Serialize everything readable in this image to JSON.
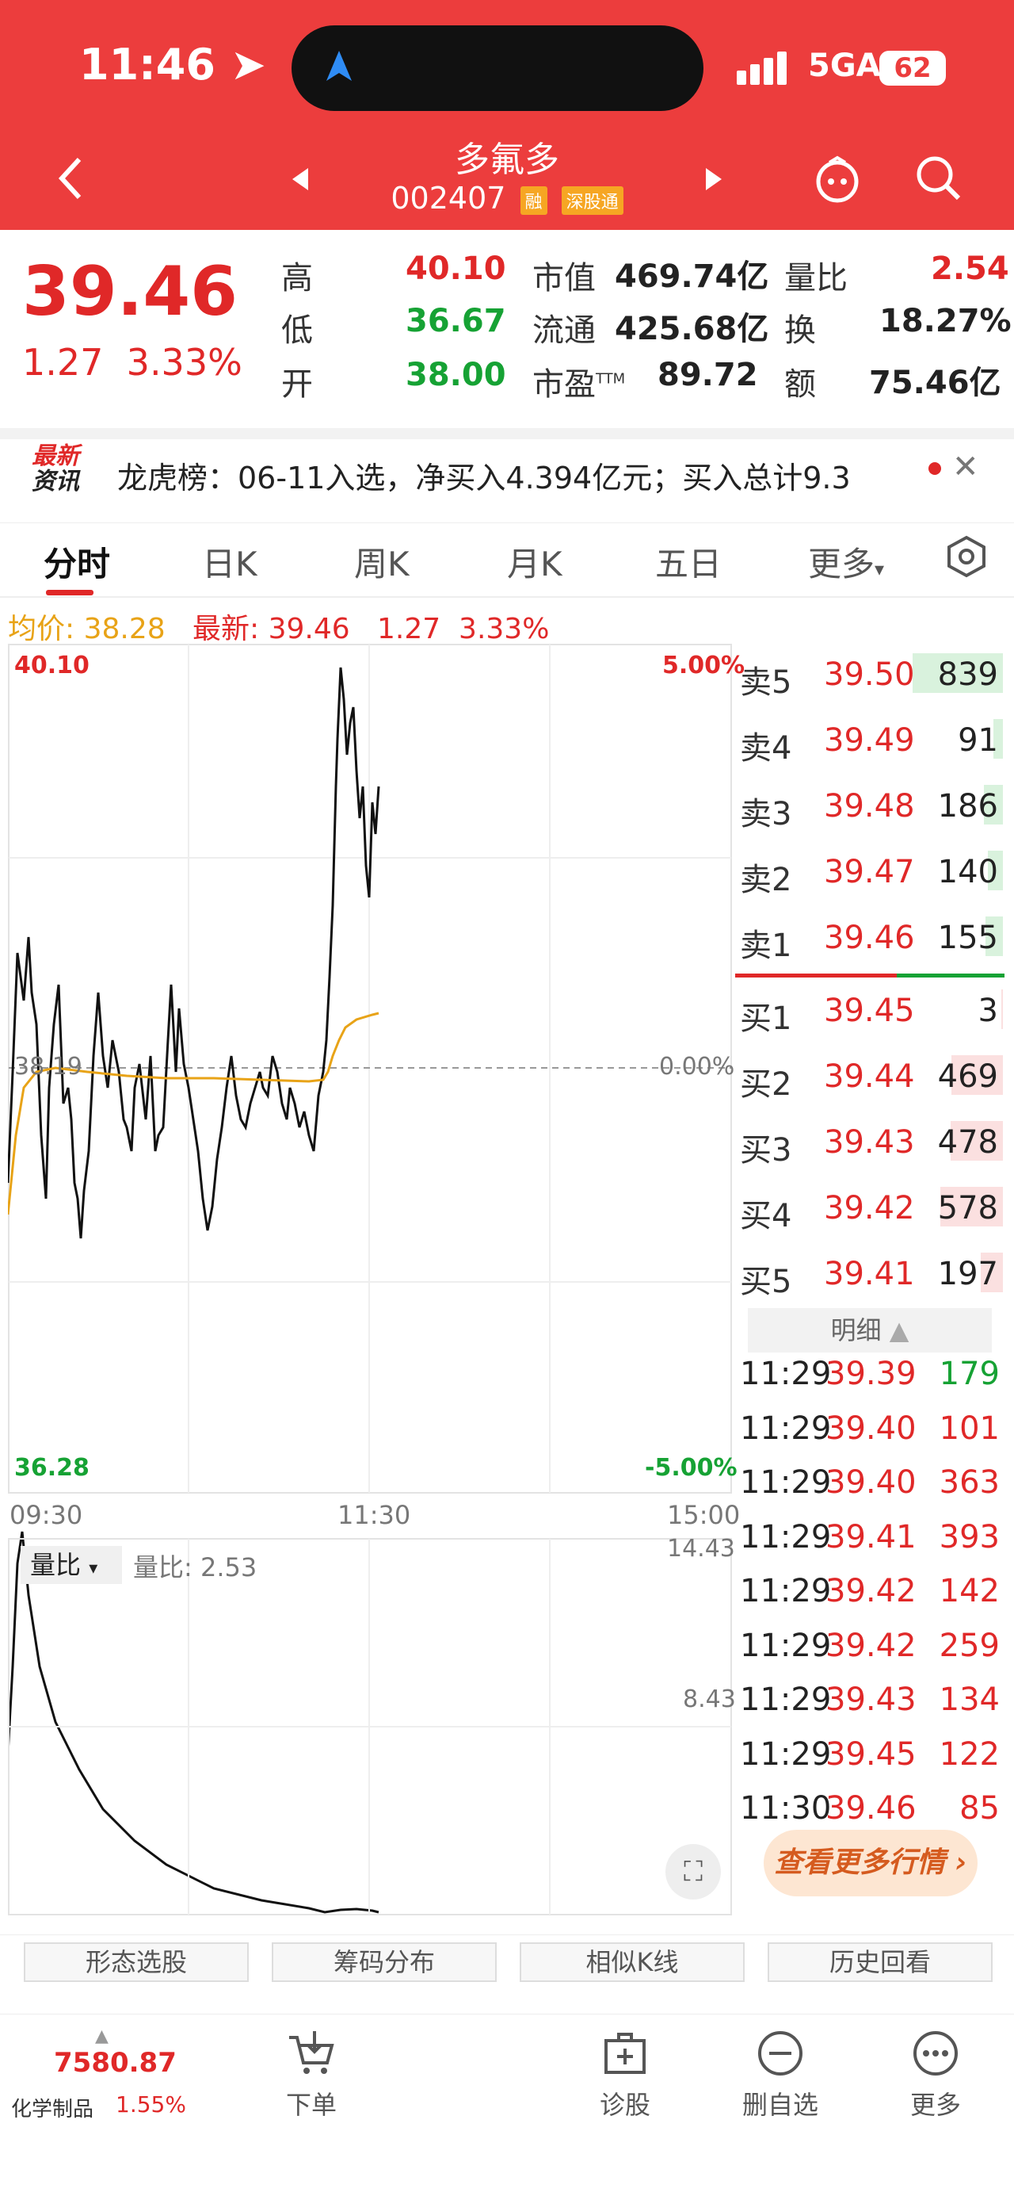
{
  "status": {
    "time": "11:46",
    "network": "5GA",
    "battery": "62"
  },
  "header": {
    "title": "多氟多",
    "code": "002407",
    "tags": [
      "融",
      "深股通"
    ]
  },
  "quote": {
    "price": "39.46",
    "change": "1.27",
    "change_pct": "3.33%",
    "high_label": "高",
    "high": "40.10",
    "low_label": "低",
    "low": "36.67",
    "open_label": "开",
    "open": "38.00",
    "mktcap_label": "市值",
    "mktcap": "469.74亿",
    "float_label": "流通",
    "float": "425.68亿",
    "pe_label": "市盈",
    "pe_sup": "TTM",
    "pe": "89.72",
    "volratio_label": "量比",
    "volratio": "2.54",
    "turnover_label": "换",
    "turnover": "18.27%",
    "amount_label": "额",
    "amount": "75.46亿"
  },
  "news": {
    "tag_line1": "最新",
    "tag_line2": "资讯",
    "text": "龙虎榜：06-11入选，净买入4.394亿元；买入总计9.3"
  },
  "tabs": [
    "分时",
    "日K",
    "周K",
    "月K",
    "五日",
    "更多"
  ],
  "avg_line": {
    "avg_label": "均价:",
    "avg": "38.28",
    "latest_label": "最新:",
    "latest": "39.46",
    "chg": "1.27",
    "pct": "3.33%"
  },
  "chart": {
    "y_top": "40.10",
    "y_bottom": "36.28",
    "y_mid": "38.19",
    "pct_top": "5.00%",
    "pct_mid": "0.00%",
    "pct_bottom": "-5.00%",
    "times": [
      "09:30",
      "11:30",
      "15:00"
    ],
    "vol_label": "量比",
    "vol_value": "量比: 2.53",
    "vol_top": "14.43",
    "vol_mid": "8.43"
  },
  "order_book": {
    "asks": [
      {
        "label": "卖5",
        "price": "39.50",
        "vol": "839",
        "fill": 0.95
      },
      {
        "label": "卖4",
        "price": "39.49",
        "vol": "91",
        "fill": 0.1
      },
      {
        "label": "卖3",
        "price": "39.48",
        "vol": "186",
        "fill": 0.2
      },
      {
        "label": "卖2",
        "price": "39.47",
        "vol": "140",
        "fill": 0.16
      },
      {
        "label": "卖1",
        "price": "39.46",
        "vol": "155",
        "fill": 0.18
      }
    ],
    "bids": [
      {
        "label": "买1",
        "price": "39.45",
        "vol": "3",
        "fill": 0.01
      },
      {
        "label": "买2",
        "price": "39.44",
        "vol": "469",
        "fill": 0.54
      },
      {
        "label": "买3",
        "price": "39.43",
        "vol": "478",
        "fill": 0.55
      },
      {
        "label": "买4",
        "price": "39.42",
        "vol": "578",
        "fill": 0.66
      },
      {
        "label": "买5",
        "price": "39.41",
        "vol": "197",
        "fill": 0.23
      }
    ],
    "detail_label": "明细",
    "ticks": [
      {
        "t": "11:29",
        "p": "39.39",
        "v": "179",
        "c": "green"
      },
      {
        "t": "11:29",
        "p": "39.40",
        "v": "101",
        "c": "red"
      },
      {
        "t": "11:29",
        "p": "39.40",
        "v": "363",
        "c": "red"
      },
      {
        "t": "11:29",
        "p": "39.41",
        "v": "393",
        "c": "red"
      },
      {
        "t": "11:29",
        "p": "39.42",
        "v": "142",
        "c": "red"
      },
      {
        "t": "11:29",
        "p": "39.42",
        "v": "259",
        "c": "red"
      },
      {
        "t": "11:29",
        "p": "39.43",
        "v": "134",
        "c": "red"
      },
      {
        "t": "11:29",
        "p": "39.45",
        "v": "122",
        "c": "red"
      },
      {
        "t": "11:30",
        "p": "39.46",
        "v": "85",
        "c": "red"
      }
    ],
    "more_label": "查看更多行情"
  },
  "func_buttons": [
    "形态选股",
    "筹码分布",
    "相似K线",
    "历史回看"
  ],
  "bottom_nav": {
    "index_value": "7580.87",
    "index_name": "化学制品",
    "index_pct": "1.55%",
    "items": [
      "下单",
      "诊股",
      "删自选",
      "更多"
    ]
  },
  "colors": {
    "brand": "#ec3d3d",
    "up": "#e02828",
    "down": "#16a234",
    "avg": "#e8a317"
  }
}
